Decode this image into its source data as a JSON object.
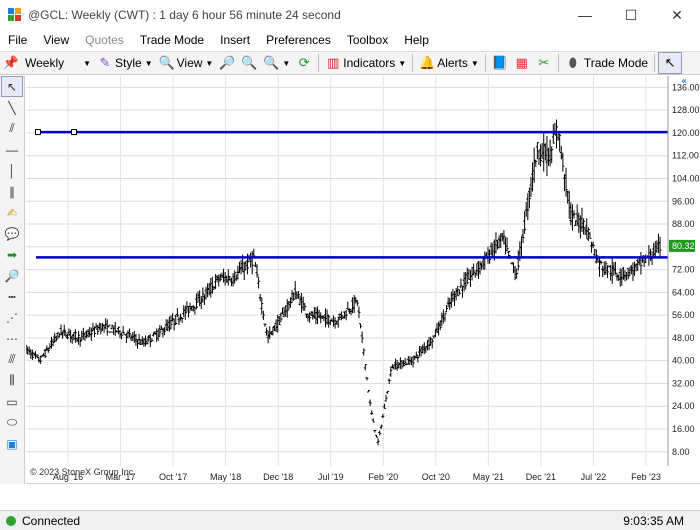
{
  "window": {
    "title": "@GCL: Weekly (CWT) : 1 day 6 hour 56 minute 24 second",
    "minimize": "—",
    "maximize": "☐",
    "close": "✕"
  },
  "menu": {
    "items": [
      {
        "label": "File",
        "enabled": true
      },
      {
        "label": "View",
        "enabled": true
      },
      {
        "label": "Quotes",
        "enabled": false
      },
      {
        "label": "Trade Mode",
        "enabled": true
      },
      {
        "label": "Insert",
        "enabled": true
      },
      {
        "label": "Preferences",
        "enabled": true
      },
      {
        "label": "Toolbox",
        "enabled": true
      },
      {
        "label": "Help",
        "enabled": true
      }
    ]
  },
  "toolbar": {
    "interval": "Weekly",
    "style_label": "Style",
    "view_label": "View",
    "indicators_label": "Indicators",
    "alerts_label": "Alerts",
    "trade_mode_label": "Trade Mode"
  },
  "left_tools": [
    "pointer-icon",
    "line-icon",
    "channel-icon",
    "horizontal-line-icon",
    "vertical-line-icon",
    "parallel-lines-icon",
    "note-icon",
    "speech-bubble-icon",
    "arrow-icon",
    "magnifier-icon",
    "dotted-lines-icon",
    "fan-icon",
    "retracement-icon",
    "gann-icon",
    "fib-icon",
    "rectangle-icon",
    "ellipse-icon",
    "scroll-icon"
  ],
  "status": {
    "connection": "Connected",
    "time": "9:03:35 AM",
    "connection_color": "#2fa32f"
  },
  "chart_data": {
    "type": "bar",
    "symbol": "@GCL",
    "interval": "Weekly",
    "copyright": "© 2023 StoneX Group Inc.",
    "y_ticks": [
      136,
      128,
      120,
      112,
      104,
      96,
      88,
      80,
      72,
      64,
      56,
      48,
      40,
      32,
      24,
      16,
      8
    ],
    "ylim": [
      3,
      140
    ],
    "last_price": "80.32",
    "last_price_color": "#1c9a1c",
    "x_labels": [
      "Aug '16",
      "Mar '17",
      "Oct '17",
      "May '18",
      "Dec '18",
      "Jul '19",
      "Feb '20",
      "Oct '20",
      "May '21",
      "Dec '21",
      "Jul '22",
      "Feb '23"
    ],
    "x_range": [
      "2016-01",
      "2023-10"
    ],
    "grid": true,
    "horizontal_lines": [
      {
        "price": 120.3,
        "color": "#0000cc"
      },
      {
        "price": 76.3,
        "color": "#0000cc"
      }
    ],
    "price_path": [
      [
        "2016-01",
        44
      ],
      [
        "2016-03",
        40
      ],
      [
        "2016-06",
        50
      ],
      [
        "2016-09",
        48
      ],
      [
        "2016-12",
        52
      ],
      [
        "2017-03",
        50
      ],
      [
        "2017-06",
        46
      ],
      [
        "2017-09",
        51
      ],
      [
        "2017-12",
        57
      ],
      [
        "2018-03",
        63
      ],
      [
        "2018-05",
        69
      ],
      [
        "2018-07",
        69
      ],
      [
        "2018-10",
        76
      ],
      [
        "2018-12",
        48
      ],
      [
        "2019-02",
        55
      ],
      [
        "2019-04",
        64
      ],
      [
        "2019-06",
        56
      ],
      [
        "2019-08",
        55
      ],
      [
        "2019-10",
        54
      ],
      [
        "2020-01",
        61
      ],
      [
        "2020-03",
        22
      ],
      [
        "2020-04",
        11
      ],
      [
        "2020-06",
        38
      ],
      [
        "2020-09",
        40
      ],
      [
        "2020-12",
        48
      ],
      [
        "2021-03",
        63
      ],
      [
        "2021-07",
        74
      ],
      [
        "2021-10",
        83
      ],
      [
        "2021-12",
        70
      ],
      [
        "2022-03",
        114
      ],
      [
        "2022-05",
        112
      ],
      [
        "2022-06",
        122
      ],
      [
        "2022-08",
        90
      ],
      [
        "2022-10",
        88
      ],
      [
        "2022-12",
        74
      ],
      [
        "2023-03",
        70
      ],
      [
        "2023-05",
        72
      ],
      [
        "2023-07",
        76
      ],
      [
        "2023-09",
        80.32
      ]
    ]
  }
}
